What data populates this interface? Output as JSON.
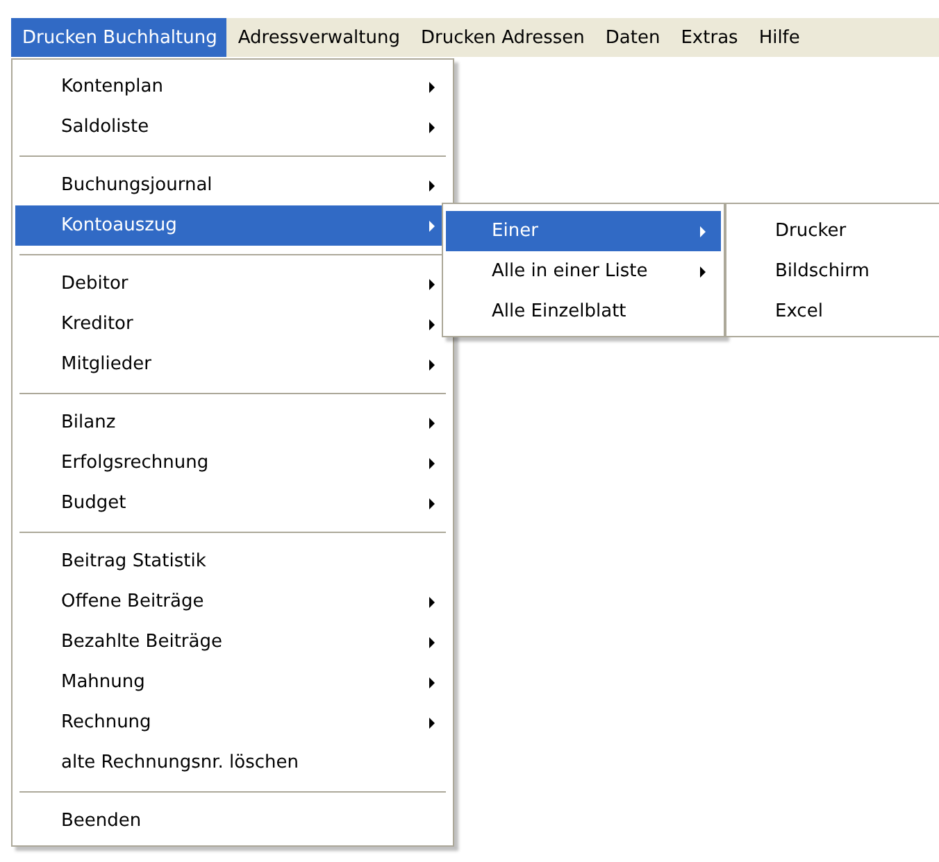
{
  "menu_bar": [
    {
      "label": "Drucken Buchhaltung",
      "selected": true
    },
    {
      "label": "Adressverwaltung",
      "selected": false
    },
    {
      "label": "Drucken Adressen",
      "selected": false
    },
    {
      "label": "Daten",
      "selected": false
    },
    {
      "label": "Extras",
      "selected": false
    },
    {
      "label": "Hilfe",
      "selected": false
    }
  ],
  "menu": {
    "items": [
      {
        "kind": "item",
        "label": "Kontenplan",
        "submenu": true,
        "selected": false
      },
      {
        "kind": "item",
        "label": "Saldoliste",
        "submenu": true,
        "selected": false
      },
      {
        "kind": "separator"
      },
      {
        "kind": "item",
        "label": "Buchungsjournal",
        "submenu": true,
        "selected": false
      },
      {
        "kind": "item",
        "label": "Kontoauszug",
        "submenu": true,
        "selected": true
      },
      {
        "kind": "separator"
      },
      {
        "kind": "item",
        "label": "Debitor",
        "submenu": true,
        "selected": false
      },
      {
        "kind": "item",
        "label": "Kreditor",
        "submenu": true,
        "selected": false
      },
      {
        "kind": "item",
        "label": "Mitglieder",
        "submenu": true,
        "selected": false
      },
      {
        "kind": "separator"
      },
      {
        "kind": "item",
        "label": "Bilanz",
        "submenu": true,
        "selected": false
      },
      {
        "kind": "item",
        "label": "Erfolgsrechnung",
        "submenu": true,
        "selected": false
      },
      {
        "kind": "item",
        "label": "Budget",
        "submenu": true,
        "selected": false
      },
      {
        "kind": "separator"
      },
      {
        "kind": "item",
        "label": "Beitrag Statistik",
        "submenu": false,
        "selected": false
      },
      {
        "kind": "item",
        "label": "Offene Beiträge",
        "submenu": true,
        "selected": false
      },
      {
        "kind": "item",
        "label": "Bezahlte Beiträge",
        "submenu": true,
        "selected": false
      },
      {
        "kind": "item",
        "label": "Mahnung",
        "submenu": true,
        "selected": false
      },
      {
        "kind": "item",
        "label": "Rechnung",
        "submenu": true,
        "selected": false
      },
      {
        "kind": "item",
        "label": "alte Rechnungsnr. löschen",
        "submenu": false,
        "selected": false
      },
      {
        "kind": "separator"
      },
      {
        "kind": "item",
        "label": "Beenden",
        "submenu": false,
        "selected": false
      }
    ]
  },
  "submenu": {
    "items": [
      {
        "kind": "item",
        "label": "Einer",
        "submenu": true,
        "selected": true
      },
      {
        "kind": "item",
        "label": "Alle in einer Liste",
        "submenu": true,
        "selected": false
      },
      {
        "kind": "item",
        "label": "Alle Einzelblatt",
        "submenu": false,
        "selected": false
      }
    ]
  },
  "submenu_2": {
    "items": [
      {
        "kind": "item",
        "label": "Drucker",
        "selected": false
      },
      {
        "kind": "item",
        "label": "Bildschirm",
        "selected": false
      },
      {
        "kind": "item",
        "label": "Excel",
        "selected": false
      }
    ]
  }
}
